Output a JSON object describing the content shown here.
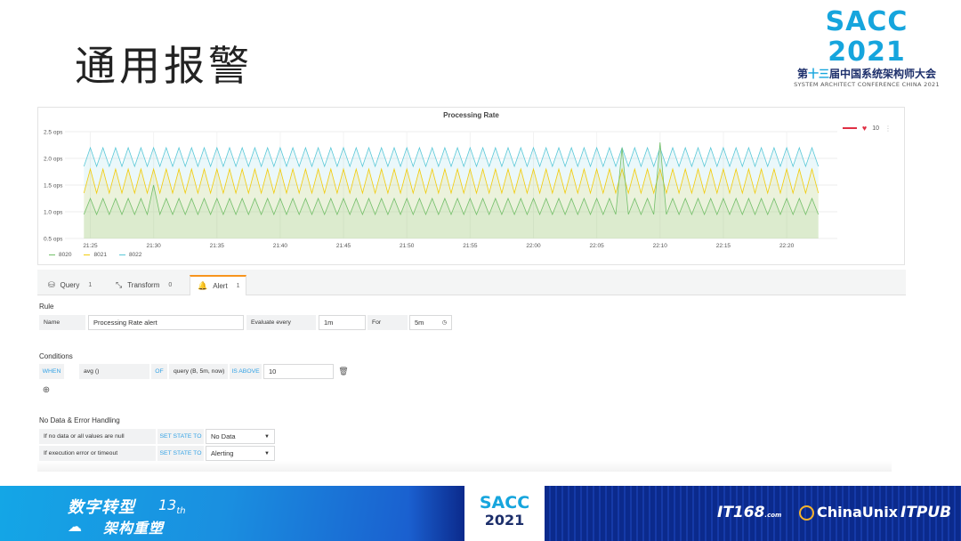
{
  "slide": {
    "title": "通用报警"
  },
  "logo": {
    "name": "SACC 2021",
    "cn_prefix": "第",
    "cn_num": "十三",
    "cn_suffix": "届中国系统架构师大会",
    "en": "SYSTEM ARCHITECT CONFERENCE CHINA 2021"
  },
  "panel": {
    "title": "Processing Rate",
    "threshold_value": "10",
    "legend": [
      {
        "name": "8020",
        "color": "#73bf69"
      },
      {
        "name": "8021",
        "color": "#f2cc0c"
      },
      {
        "name": "8022",
        "color": "#5ac8d8"
      }
    ]
  },
  "chart_data": {
    "type": "area",
    "title": "Processing Rate",
    "y_ticks": [
      "2.5 ops",
      "2.0 ops",
      "1.5 ops",
      "1.0 ops",
      "0.5 ops"
    ],
    "ylim": [
      0.5,
      2.5
    ],
    "x_ticks": [
      "21:25",
      "21:30",
      "21:35",
      "21:40",
      "21:45",
      "21:50",
      "21:55",
      "22:00",
      "22:05",
      "22:10",
      "22:15",
      "22:20"
    ],
    "x_range": [
      "21:23",
      "22:24"
    ],
    "series": [
      {
        "name": "8020",
        "color": "#73bf69",
        "low": 0.95,
        "high": 1.25,
        "spikes": [
          {
            "t": "21:30",
            "v": 1.5
          },
          {
            "t": "22:07",
            "v": 2.2
          },
          {
            "t": "22:10",
            "v": 2.3
          }
        ]
      },
      {
        "name": "8021",
        "color": "#f2cc0c",
        "low": 1.35,
        "high": 1.8
      },
      {
        "name": "8022",
        "color": "#5ac8d8",
        "low": 1.85,
        "high": 2.2
      }
    ],
    "legend_position": "bottom-left",
    "grid": true
  },
  "tabs": [
    {
      "label": "Query",
      "count": "1",
      "icon": "database-icon"
    },
    {
      "label": "Transform",
      "count": "0",
      "icon": "transform-icon"
    },
    {
      "label": "Alert",
      "count": "1",
      "icon": "bell-icon"
    }
  ],
  "rule": {
    "heading": "Rule",
    "name_label": "Name",
    "name_value": "Processing Rate alert",
    "eval_label": "Evaluate every",
    "eval_value": "1m",
    "for_label": "For",
    "for_value": "5m"
  },
  "conditions": {
    "heading": "Conditions",
    "when": "WHEN",
    "reducer": "avg ()",
    "of": "OF",
    "query": "query (B, 5m, now)",
    "is_above": "IS ABOVE",
    "threshold": "10"
  },
  "nodata": {
    "heading": "No Data & Error Handling",
    "row1_label": "If no data or all values are null",
    "row1_kw": "SET STATE TO",
    "row1_value": "No Data",
    "row2_label": "If execution error or timeout",
    "row2_kw": "SET STATE TO",
    "row2_value": "Alerting"
  },
  "footer": {
    "title": "数字转型",
    "edition": "13",
    "edition_suffix": "th",
    "subtitle": "架构重塑",
    "sacc": "SACC",
    "year": "2021",
    "brand1": "IT168",
    "brand1_suffix": ".com",
    "brand2": "ChinaUnix",
    "brand3": "ITPUB"
  }
}
